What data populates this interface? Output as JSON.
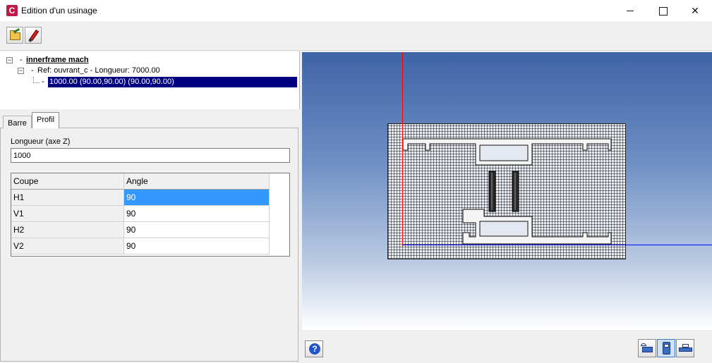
{
  "window": {
    "title": "Edition d'un usinage",
    "app_icon_letter": "C",
    "minimize": "minimize-icon",
    "maximize": "maximize-icon",
    "close": "✕"
  },
  "toolbar": {
    "open_icon": "folder-open-icon",
    "edit_icon": "pencil-icon"
  },
  "tree": {
    "root_toggle": "−",
    "root_label": "innerframe mach",
    "ref_toggle": "−",
    "ref_label": "Ref: ouvrant_c - Longueur: 7000.00",
    "selected_label": "1000.00 (90.00,90.00) (90.00,90.00)"
  },
  "tabs": [
    {
      "label": "Barre"
    },
    {
      "label": "Profil"
    }
  ],
  "profil": {
    "longueur_label": "Longueur (axe Z)",
    "longueur_value": "1000"
  },
  "grid": {
    "headers": [
      "Coupe",
      "Angle"
    ],
    "rows": [
      {
        "coupe": "H1",
        "angle": "90"
      },
      {
        "coupe": "V1",
        "angle": "90"
      },
      {
        "coupe": "H2",
        "angle": "90"
      },
      {
        "coupe": "V2",
        "angle": "90"
      }
    ]
  },
  "viewport": {
    "axis_x_color": "#0000ff",
    "axis_y_color": "#ff0000"
  },
  "bottom": {
    "help_label": "?",
    "help_icon": "help-icon",
    "view_icons": [
      "rotate-view-icon",
      "front-view-icon",
      "side-view-icon"
    ]
  }
}
